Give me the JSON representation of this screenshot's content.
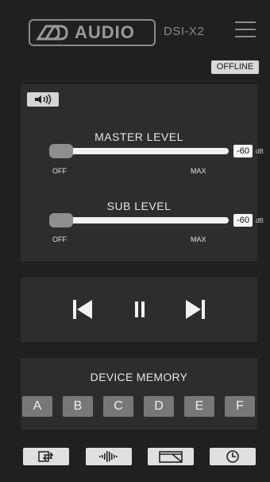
{
  "header": {
    "brand": "AUDIO",
    "model": "DSI-X2",
    "status": "OFFLINE"
  },
  "levels": {
    "master": {
      "title": "MASTER LEVEL",
      "value": "-60",
      "unit": "dB",
      "min_label": "OFF",
      "max_label": "MAX",
      "fraction": 0.0
    },
    "sub": {
      "title": "SUB LEVEL",
      "value": "-60",
      "unit": "dB",
      "min_label": "OFF",
      "max_label": "MAX",
      "fraction": 0.0
    }
  },
  "transport": {
    "icons": [
      "skip-previous-icon",
      "pause-icon",
      "skip-next-icon"
    ]
  },
  "memory": {
    "title": "DEVICE MEMORY",
    "slots": [
      "A",
      "B",
      "C",
      "D",
      "E",
      "F"
    ]
  },
  "bottom": {
    "icons": [
      "input-select-icon",
      "waveform-icon",
      "screen-icon",
      "clock-icon"
    ]
  },
  "colors": {
    "background": "#202020",
    "panel": "#2d2d2d",
    "button": "#787878",
    "accent": "#e0e0e0"
  }
}
